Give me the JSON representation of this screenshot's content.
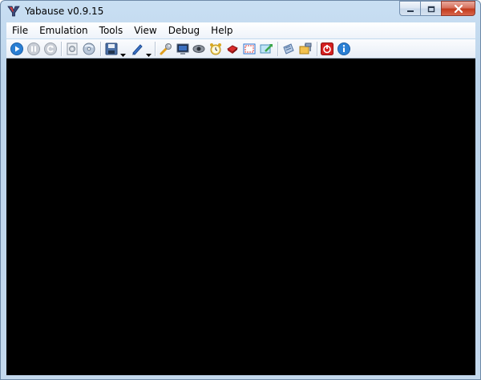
{
  "window": {
    "title": "Yabause v0.9.15",
    "app_icon": "yabause-logo-icon"
  },
  "caption_buttons": {
    "minimize_icon": "minimize-icon",
    "maximize_icon": "maximize-icon",
    "close_icon": "close-icon"
  },
  "menu": {
    "items": [
      {
        "label": "File"
      },
      {
        "label": "Emulation"
      },
      {
        "label": "Tools"
      },
      {
        "label": "View"
      },
      {
        "label": "Debug"
      },
      {
        "label": "Help"
      }
    ]
  },
  "toolbar": {
    "buttons": [
      {
        "icon": "run-icon"
      },
      {
        "icon": "pause-icon"
      },
      {
        "icon": "reset-icon"
      },
      {
        "icon": "open-iso-icon"
      },
      {
        "icon": "open-cd-icon"
      },
      {
        "icon": "save-state-icon"
      },
      {
        "icon": "load-state-icon"
      },
      {
        "icon": "settings-icon"
      },
      {
        "icon": "screenshot-icon"
      },
      {
        "icon": "cheats-icon"
      },
      {
        "icon": "frame-limiter-icon"
      },
      {
        "icon": "memory-editor-icon"
      },
      {
        "icon": "fullscreen-icon"
      },
      {
        "icon": "transfer-icon"
      },
      {
        "icon": "backup-ram-icon"
      },
      {
        "icon": "patch-icon"
      },
      {
        "icon": "quit-icon"
      },
      {
        "icon": "about-icon"
      }
    ]
  },
  "colors": {
    "screen": "#000000",
    "accent": "#2a7fd4",
    "close_button": "#c23a1c"
  }
}
